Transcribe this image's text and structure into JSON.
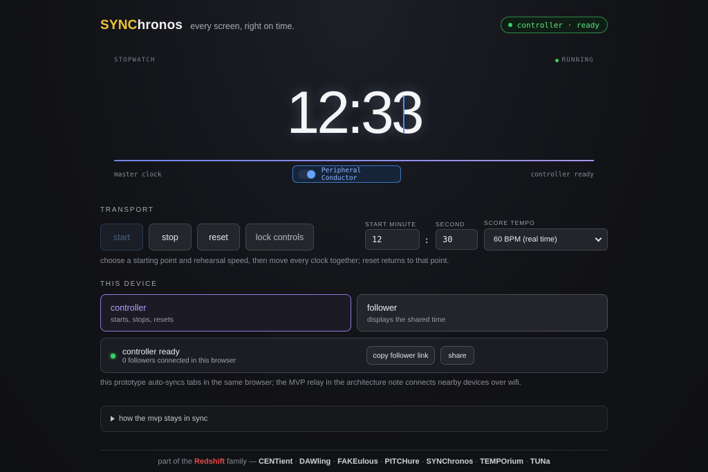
{
  "header": {
    "brand_sync": "SYNC",
    "brand_rest": "hronos",
    "tagline": "every screen, right on time.",
    "status": "controller · ready"
  },
  "clock": {
    "label": "STOPWATCH",
    "running": "RUNNING",
    "time": "12:33",
    "master": "master clock",
    "conductor": "Peripheral Conductor",
    "right_status": "controller ready"
  },
  "transport": {
    "title": "TRANSPORT",
    "start": "start",
    "stop": "stop",
    "reset": "reset",
    "lock": "lock controls",
    "minute_label": "START MINUTE",
    "minute": "12",
    "second_label": "SECOND",
    "second": "30",
    "tempo_label": "SCORE TEMPO",
    "tempo": "60 BPM (real time)",
    "hint": "choose a starting point and rehearsal speed, then move every clock together; reset returns to that point."
  },
  "device": {
    "title": "THIS DEVICE",
    "controller_title": "controller",
    "controller_sub": "starts, stops, resets",
    "follower_title": "follower",
    "follower_sub": "displays the shared time",
    "status_title": "controller ready",
    "status_sub": "0 followers connected in this browser",
    "copy_link": "copy follower link",
    "share": "share",
    "note": "this prototype auto-syncs tabs in the same browser; the MVP relay in the architecture note connects nearby devices over wifi."
  },
  "details": {
    "summary": "how the mvp stays in sync"
  },
  "footer": {
    "prefix": "part of the",
    "family_name": "Redshift",
    "family_suffix": "family —",
    "apps": [
      "CENTient",
      "DAWling",
      "FAKEulous",
      "PITCHure",
      "SYNChronos",
      "TEMPOrium",
      "TUNa"
    ],
    "separator": "·"
  },
  "colors": {
    "accent_yellow": "#f2c233",
    "accent_green": "#37d367",
    "accent_purple": "#8d7ad9",
    "accent_blue": "#4f8fff",
    "redshift": "#e64a4a"
  }
}
